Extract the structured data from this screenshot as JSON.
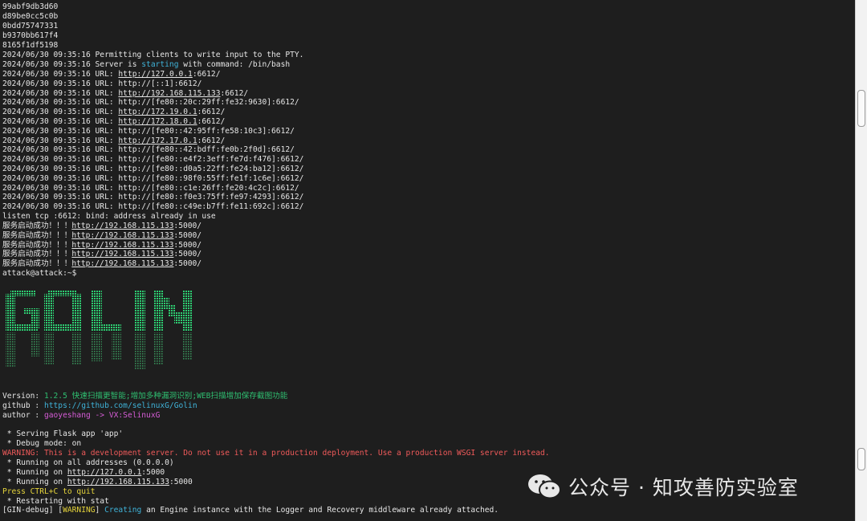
{
  "terminal": {
    "top_lines": [
      "99abf9db3d60",
      "d89be0cc5c0b",
      "0bdd75747331",
      "b9370bb617f4",
      "8165f1df5198"
    ],
    "pty_line": "2024/06/30 09:35:16 Permitting clients to write input to the PTY.",
    "server": {
      "prefix": "2024/06/30 09:35:16 Server is ",
      "word": "starting",
      "suffix": " with command: /bin/bash"
    },
    "url_prefix": "2024/06/30 09:35:16 URL: ",
    "urls": [
      {
        "pre": "http://",
        "link": "127.0.0.1",
        "post": ":6612/",
        "underline": true
      },
      {
        "pre": "http://[::1]:6612/",
        "link": "",
        "post": "",
        "underline": false
      },
      {
        "pre": "http://",
        "link": "192.168.115.133",
        "post": ":6612/",
        "underline": true
      },
      {
        "pre": "http://[fe80::20c:29ff:fe32:9630]:6612/",
        "link": "",
        "post": "",
        "underline": false
      },
      {
        "pre": "http://",
        "link": "172.19.0.1",
        "post": ":6612/",
        "underline": true
      },
      {
        "pre": "http://",
        "link": "172.18.0.1",
        "post": ":6612/",
        "underline": true
      },
      {
        "pre": "http://[fe80::42:95ff:fe58:10c3]:6612/",
        "link": "",
        "post": "",
        "underline": false
      },
      {
        "pre": "http://",
        "link": "172.17.0.1",
        "post": ":6612/",
        "underline": true
      },
      {
        "pre": "http://[fe80::42:bdff:fe0b:2f0d]:6612/",
        "link": "",
        "post": "",
        "underline": false
      },
      {
        "pre": "http://[fe80::e4f2:3eff:fe7d:f476]:6612/",
        "link": "",
        "post": "",
        "underline": false
      },
      {
        "pre": "http://[fe80::d0a5:22ff:fe24:ba12]:6612/",
        "link": "",
        "post": "",
        "underline": false
      },
      {
        "pre": "http://[fe80::98f0:55ff:fe1f:1c6e]:6612/",
        "link": "",
        "post": "",
        "underline": false
      },
      {
        "pre": "http://[fe80::c1e:26ff:fe20:4c2c]:6612/",
        "link": "",
        "post": "",
        "underline": false
      },
      {
        "pre": "http://[fe80::f0e3:75ff:fe97:4293]:6612/",
        "link": "",
        "post": "",
        "underline": false
      },
      {
        "pre": "http://[fe80::c49e:b7ff:fe11:692c]:6612/",
        "link": "",
        "post": "",
        "underline": false
      }
    ],
    "listen_line": "listen tcp :6612: bind: address already in use",
    "service_lines": {
      "prefix": "服务启动成功！！！",
      "http": "http://",
      "ip": "192.168.115.133",
      "port": ":5000/",
      "count": 5
    },
    "prompt": "attack@attack:~$",
    "version": {
      "label": "Version: ",
      "value": "1.2.5 快速扫描更智能;增加多种漏洞识别;WEB扫描增加保存截图功能"
    },
    "github": {
      "label": "github : ",
      "value": "https://github.com/selinuxG/Golin"
    },
    "author": {
      "label": "author : ",
      "value": "gaoyeshang -> VX:SelinuxG"
    },
    "flask": {
      "serving": " * Serving Flask app 'app'",
      "debug": " * Debug mode: on",
      "warning": "WARNING: This is a development server. Do not use it in a production deployment. Use a production WSGI server instead.",
      "running_all": " * Running on all addresses (0.0.0.0)",
      "running_local": {
        "pre": " * Running on ",
        "http": "http://",
        "ip": "127.0.0.1",
        "post": ":5000"
      },
      "running_ip": {
        "pre": " * Running on ",
        "http": "http://",
        "ip": "192.168.115.133",
        "post": ":5000"
      },
      "quit": "Press CTRL+C to quit",
      "restart": " * Restarting with stat"
    },
    "gin": {
      "pre": "[GIN-debug] [",
      "tag": "WARNING",
      "mid": "] ",
      "word": "Creating",
      "post": " an Engine instance with the Logger and Recovery middleware already attached."
    }
  },
  "logo": {
    "name": "GOLIN",
    "color": "#2ecc71"
  },
  "watermark": {
    "icon": "wechat-icon",
    "text": "公众号 · 知攻善防实验室"
  }
}
